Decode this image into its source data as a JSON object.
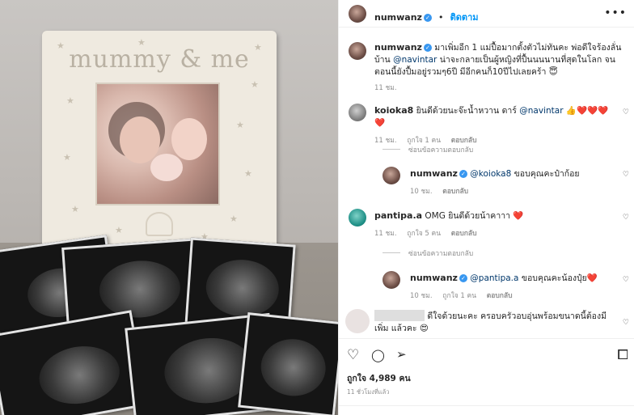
{
  "photo": {
    "frame_title": "mummy & me"
  },
  "header": {
    "username": "numwanz",
    "follow_label": "ติดตาม",
    "verified_glyph": "✓",
    "more_icon": "•••"
  },
  "caption": {
    "username": "numwanz",
    "text_before": "มาเพิ่มอีก 1 แม่ปื้อมากตั้งตัวไม่ทันคะ พ่อดีใจร้องลั่นบ้าน",
    "mention": "@navintar",
    "text_after": "น่าจะกลายเป็นผู้หญิงที่ปื้นนนนานที่สุดในโลก จนตอนนี้ยังปื้มอยู่รวมๆ6ปี มีอีกคนก็10ปีไปเลยคร้า 😇",
    "time": "11 ชม."
  },
  "comments": [
    {
      "username": "koioka8",
      "text_before": "ยินดีด้วยนะจ๊ะน้ำหวาน ดาร์",
      "mention": "@navintar",
      "text_after": "👍❤️❤️❤️❤️",
      "time": "11 ชม.",
      "likes": "ถูกใจ 1 คน",
      "reply_label": "ตอบกลับ",
      "hide_replies": "ซ่อนข้อความตอบกลับ"
    },
    {
      "username": "numwanz",
      "mention": "@koioka8",
      "text_after": "ขอบคุณคะป๋าก้อย",
      "time": "10 ชม.",
      "reply_label": "ตอบกลับ"
    },
    {
      "username": "pantipa.a",
      "text_before": "OMG ยินดีด้วยน้าคาาา",
      "text_after": "❤️",
      "time": "11 ชม.",
      "likes": "ถูกใจ 5 คน",
      "reply_label": "ตอบกลับ",
      "hide_replies": "ซ่อนข้อความตอบกลับ"
    },
    {
      "username": "numwanz",
      "mention": "@pantipa.a",
      "text_after": "ขอบคุณคะน้องปุ๋ย❤️",
      "time": "10 ชม.",
      "likes": "ถูกใจ 1 คน",
      "reply_label": "ตอบกลับ"
    },
    {
      "text_before": "ดีใจด้วยนะคะ ครอบครัวอบอุ่นพร้อมขนาดนี้ต้องมีเพิ่ม",
      "text_after": "แล้วคะ 😍"
    }
  ],
  "actions": {
    "like_icon": "♡",
    "comment_icon": "◯",
    "share_icon": "➢",
    "save_icon": "⧠",
    "likes_label": "ถูกใจ 4,989 คน",
    "post_time": "11 ชั่วโมงที่แล้ว"
  },
  "icons": {
    "comment_heart": "♡"
  }
}
